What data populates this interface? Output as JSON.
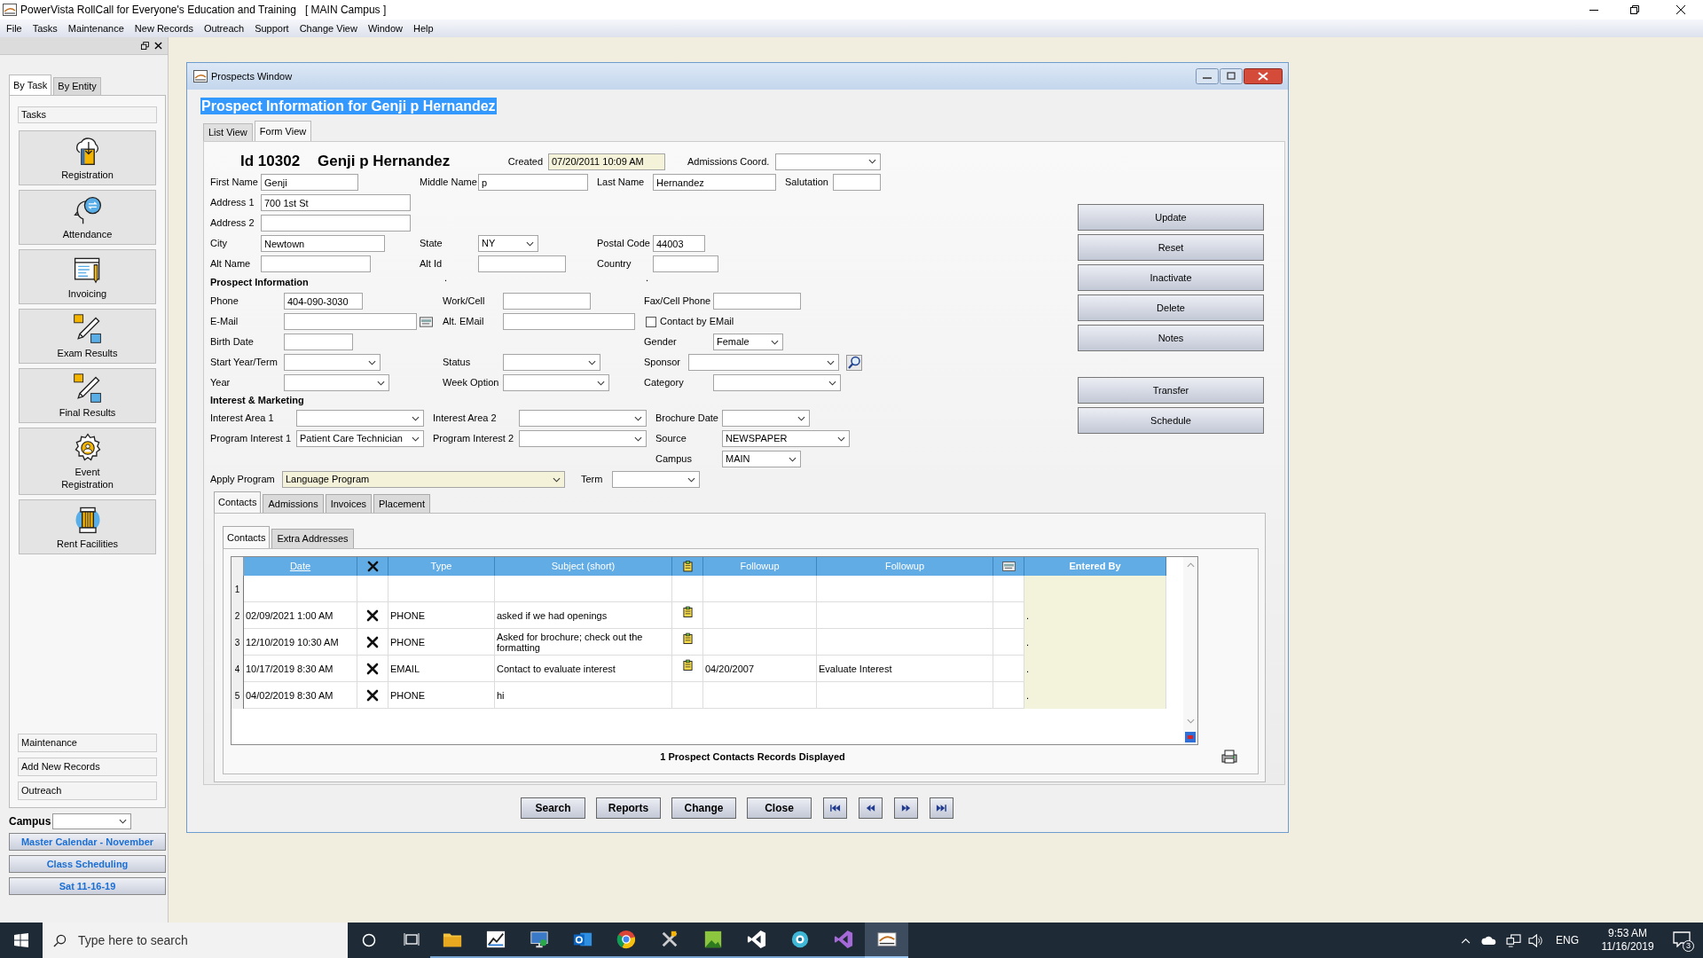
{
  "app": {
    "title": "PowerVista RollCall for Everyone's Education and Training",
    "campus_tag": "[ MAIN Campus ]"
  },
  "menu": [
    "File",
    "Tasks",
    "Maintenance",
    "New Records",
    "Outreach",
    "Support",
    "Change View",
    "Window",
    "Help"
  ],
  "sidebar": {
    "tabs": [
      {
        "label": "By Task",
        "selected": true
      },
      {
        "label": "By Entity",
        "selected": false
      }
    ],
    "header": "Tasks",
    "tasks": [
      {
        "label": "Registration",
        "kind": "registration"
      },
      {
        "label": "Attendance",
        "kind": "attendance"
      },
      {
        "label": "Invoicing",
        "kind": "invoicing"
      },
      {
        "label": "Exam Results",
        "kind": "exam"
      },
      {
        "label": "Final Results",
        "kind": "exam"
      },
      {
        "label": "Event Registration",
        "kind": "event"
      },
      {
        "label": "Rent Facilities",
        "kind": "rent"
      }
    ],
    "sections": [
      "Maintenance",
      "Add New Records",
      "Outreach"
    ],
    "campus_label": "Campus",
    "shortcuts": [
      "Master Calendar - November",
      "Class Scheduling",
      "Sat 11-16-19"
    ]
  },
  "window": {
    "title": "Prospects Window",
    "heading": "Prospect Information for Genji p Hernandez",
    "view_tabs": [
      {
        "label": "List View",
        "selected": false
      },
      {
        "label": "Form View",
        "selected": true
      }
    ],
    "record": {
      "id": "Id 10302",
      "name": "Genji p Hernandez"
    },
    "fields": {
      "created": {
        "label": "Created",
        "kind": "text",
        "value": "07/20/2011 10:09 AM",
        "highlighted": true
      },
      "admissions_coord": {
        "label": "Admissions Coord.",
        "kind": "select"
      },
      "first_name": {
        "label": "First Name",
        "kind": "text",
        "value": "Genji"
      },
      "middle_name": {
        "label": "Middle Name",
        "kind": "text",
        "value": "p"
      },
      "last_name": {
        "label": "Last Name",
        "kind": "text",
        "value": "Hernandez"
      },
      "salutation": {
        "label": "Salutation",
        "kind": "text"
      },
      "address_1": {
        "label": "Address 1",
        "kind": "text",
        "value": "700 1st St"
      },
      "address_2": {
        "label": "Address 2",
        "kind": "text"
      },
      "city": {
        "label": "City",
        "kind": "text",
        "value": "Newtown"
      },
      "state": {
        "label": "State",
        "kind": "select",
        "value": "NY"
      },
      "postal_code": {
        "label": "Postal Code",
        "kind": "text",
        "value": "44003"
      },
      "alt_name": {
        "label": "Alt Name",
        "kind": "text"
      },
      "alt_id": {
        "label": "Alt Id",
        "kind": "text"
      },
      "country": {
        "label": "Country",
        "kind": "text"
      },
      "phone": {
        "label": "Phone",
        "kind": "text",
        "value": "404-090-3030"
      },
      "work_cell": {
        "label": "Work/Cell",
        "kind": "text"
      },
      "fax_cell": {
        "label": "Fax/Cell Phone",
        "kind": "text"
      },
      "email": {
        "label": "E-Mail",
        "kind": "text"
      },
      "alt_email": {
        "label": "Alt. EMail",
        "kind": "text"
      },
      "contact_by_email": {
        "label": "Contact by EMail",
        "kind": "check",
        "checked": false
      },
      "birth_date": {
        "label": "Birth Date",
        "kind": "text"
      },
      "gender": {
        "label": "Gender",
        "kind": "select",
        "value": "Female"
      },
      "start_year_term": {
        "label": "Start Year/Term",
        "kind": "select"
      },
      "status": {
        "label": "Status",
        "kind": "select"
      },
      "sponsor": {
        "label": "Sponsor",
        "kind": "select"
      },
      "year": {
        "label": "Year",
        "kind": "select"
      },
      "week_option": {
        "label": "Week Option",
        "kind": "select"
      },
      "category": {
        "label": "Category",
        "kind": "select"
      },
      "interest_area_1": {
        "label": "Interest Area 1",
        "kind": "select"
      },
      "interest_area_2": {
        "label": "Interest Area 2",
        "kind": "select"
      },
      "brochure_date": {
        "label": "Brochure Date",
        "kind": "select"
      },
      "program_interest_1": {
        "label": "Program Interest 1",
        "kind": "select",
        "value": "Patient Care Technician"
      },
      "program_interest_2": {
        "label": "Program Interest 2",
        "kind": "select"
      },
      "source": {
        "label": "Source",
        "kind": "select",
        "value": "NEWSPAPER"
      },
      "campus": {
        "label": "Campus",
        "kind": "select",
        "value": "MAIN"
      },
      "apply_program": {
        "label": "Apply Program",
        "kind": "select",
        "value": "Language Program",
        "highlighted": true
      },
      "term": {
        "label": "Term",
        "kind": "select"
      }
    },
    "section_headings": [
      "Prospect Information",
      "Interest & Marketing"
    ],
    "separator_marks": [
      ".",
      "."
    ],
    "actions": [
      "Update",
      "Reset",
      "Inactivate",
      "Delete",
      "Notes",
      "Transfer",
      "Schedule"
    ],
    "detail_tabs": [
      {
        "label": "Contacts",
        "selected": true
      },
      {
        "label": "Admissions",
        "selected": false
      },
      {
        "label": "Invoices",
        "selected": false
      },
      {
        "label": "Placement",
        "selected": false
      }
    ],
    "sub_tabs": [
      {
        "label": "Contacts",
        "selected": true
      },
      {
        "label": "Extra Addresses",
        "selected": false
      }
    ],
    "grid": {
      "columns": [
        {
          "kind": "date",
          "label": "Date",
          "sorted": true,
          "highlighted": false
        },
        {
          "kind": "delete",
          "sorted": false,
          "highlighted": false
        },
        {
          "kind": "type",
          "label": "Type",
          "sorted": false,
          "highlighted": false
        },
        {
          "kind": "subject",
          "label": "Subject (short)",
          "sorted": false,
          "highlighted": false
        },
        {
          "kind": "note",
          "sorted": false,
          "highlighted": false
        },
        {
          "kind": "followup_date",
          "label": "Followup",
          "sorted": false,
          "highlighted": false
        },
        {
          "kind": "followup_text",
          "label": "Followup",
          "sorted": false,
          "highlighted": false
        },
        {
          "kind": "card",
          "sorted": false,
          "highlighted": false
        },
        {
          "kind": "entered_by",
          "label": "Entered By",
          "sorted": false,
          "highlighted": true
        }
      ],
      "rows": [
        {
          "number": "1",
          "delete": false,
          "note": false
        },
        {
          "number": "2",
          "date": "02/09/2021 1:00 AM",
          "delete": true,
          "type": "PHONE",
          "subject": "asked if we had openings",
          "note": true,
          "entered_by": "."
        },
        {
          "number": "3",
          "date": "12/10/2019 10:30 AM",
          "delete": true,
          "type": "PHONE",
          "subject": "Asked for brochure; check out the formatting",
          "note": true,
          "entered_by": "."
        },
        {
          "number": "4",
          "date": "10/17/2019 8:30 AM",
          "delete": true,
          "type": "EMAIL",
          "subject": "Contact to evaluate interest",
          "note": true,
          "followup_date": "04/20/2007",
          "followup_text": "Evaluate Interest",
          "entered_by": "."
        },
        {
          "number": "5",
          "date": "04/02/2019 8:30 AM",
          "delete": true,
          "type": "PHONE",
          "subject": "hi",
          "note": false,
          "entered_by": "."
        }
      ],
      "records_label": "1 Prospect Contacts Records Displayed"
    },
    "bottom_buttons": [
      "Search",
      "Reports",
      "Change",
      "Close"
    ]
  },
  "taskbar": {
    "search_placeholder": "Type here to search",
    "apps": [
      {
        "kind": "folder",
        "selected": false
      },
      {
        "kind": "chart",
        "selected": false
      },
      {
        "kind": "monitor",
        "selected": false
      },
      {
        "kind": "mail",
        "selected": false
      },
      {
        "kind": "browser",
        "selected": false
      },
      {
        "kind": "tools",
        "selected": false
      },
      {
        "kind": "image",
        "selected": false
      },
      {
        "kind": "code",
        "selected": false
      },
      {
        "kind": "camera",
        "selected": false
      },
      {
        "kind": "studio",
        "selected": false
      },
      {
        "kind": "rollcall",
        "selected": true
      }
    ],
    "language": "ENG",
    "time": "9:53 AM",
    "date": "11/16/2019",
    "notifications": "3"
  }
}
